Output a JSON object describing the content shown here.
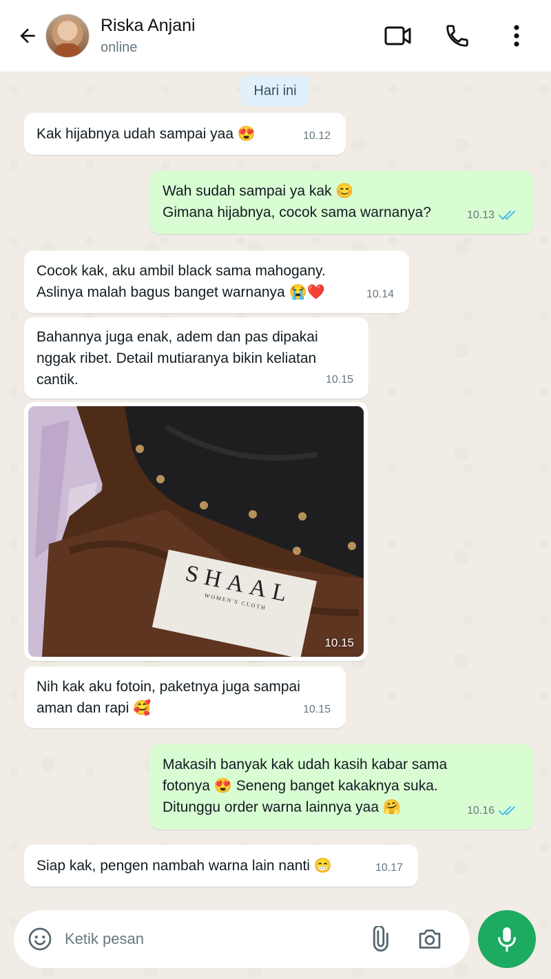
{
  "header": {
    "contact_name": "Riska Anjani",
    "status": "online"
  },
  "date_chip": "Hari ini",
  "messages": [
    {
      "direction": "incoming",
      "text": "Kak hijabnya udah sampai yaa 😍",
      "time": "10.12"
    },
    {
      "direction": "outgoing",
      "text": "Wah sudah sampai ya kak 😊\nGimana hijabnya, cocok sama warnanya?",
      "time": "10.13",
      "status": "read"
    },
    {
      "direction": "incoming",
      "text": "Cocok kak, aku ambil black sama mahogany.\nAslinya malah bagus banget warnanya 😭❤️",
      "time": "10.14"
    },
    {
      "direction": "incoming",
      "text": "Bahannya juga enak, adem dan pas dipakai\nnggak ribet. Detail mutiaranya bikin keliatan\ncantik.",
      "time": "10.15"
    },
    {
      "direction": "incoming",
      "type": "image",
      "time": "10.15",
      "label_brand": "SHAAL",
      "label_sub": "WOMEN'S CLOTH"
    },
    {
      "direction": "incoming",
      "text": "Nih kak aku fotoin, paketnya juga sampai\naman dan rapi 🥰",
      "time": "10.15"
    },
    {
      "direction": "outgoing",
      "text": "Makasih banyak kak udah kasih kabar sama\nfotonya 😍 Seneng banget kakaknya suka.\nDitunggu order warna lainnya yaa 🤗",
      "time": "10.16",
      "status": "read"
    },
    {
      "direction": "incoming",
      "text": "Siap kak, pengen nambah warna lain nanti 😁",
      "time": "10.17"
    }
  ],
  "composer": {
    "placeholder": "Ketik pesan"
  },
  "colors": {
    "incoming_bubble": "#ffffff",
    "outgoing_bubble": "#d9fdd3",
    "read_tick": "#53bdeb",
    "mic_button": "#1daa61"
  },
  "icons": [
    "back-arrow-icon",
    "video-call-icon",
    "phone-icon",
    "more-options-icon",
    "emoji-icon",
    "paperclip-icon",
    "camera-icon",
    "microphone-icon",
    "double-check-icon"
  ]
}
